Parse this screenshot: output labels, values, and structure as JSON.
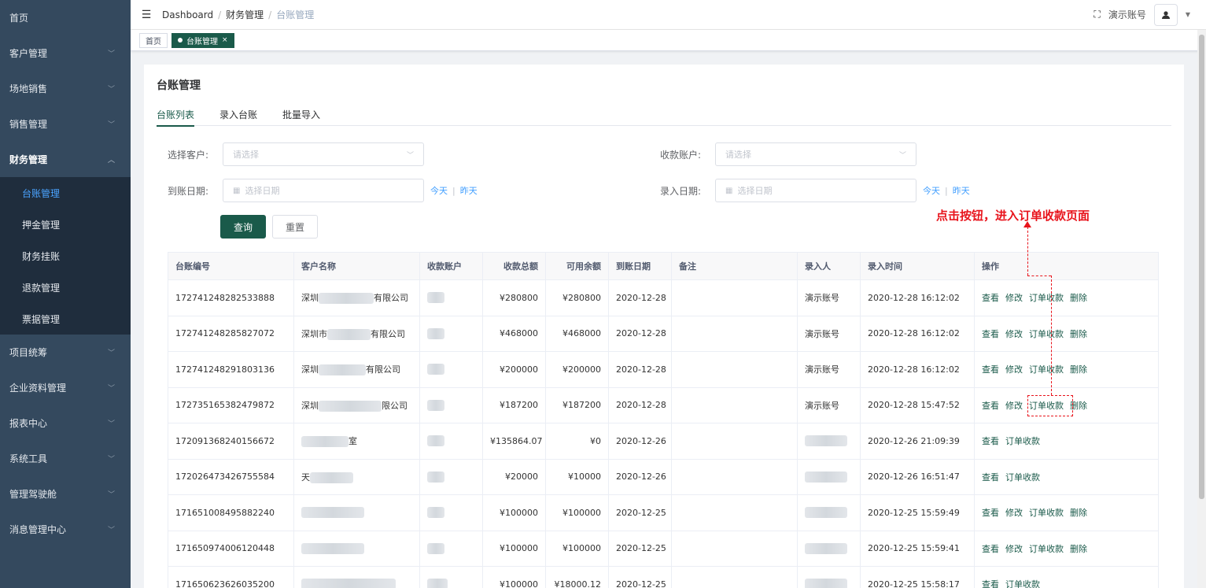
{
  "sidebar": {
    "items": [
      {
        "label": "首页"
      },
      {
        "label": "客户管理"
      },
      {
        "label": "场地销售"
      },
      {
        "label": "销售管理"
      },
      {
        "label": "财务管理"
      },
      {
        "label": "项目统筹"
      },
      {
        "label": "企业资料管理"
      },
      {
        "label": "报表中心"
      },
      {
        "label": "系统工具"
      },
      {
        "label": "管理驾驶舱"
      },
      {
        "label": "消息管理中心"
      }
    ],
    "finance_sub": [
      {
        "label": "台账管理"
      },
      {
        "label": "押金管理"
      },
      {
        "label": "财务挂账"
      },
      {
        "label": "退款管理"
      },
      {
        "label": "票据管理"
      }
    ]
  },
  "navbar": {
    "breadcrumb": [
      "Dashboard",
      "财务管理",
      "台账管理"
    ],
    "account": "演示账号"
  },
  "tags": {
    "home": "首页",
    "current": "台账管理"
  },
  "page": {
    "title": "台账管理",
    "tabs": [
      "台账列表",
      "录入台账",
      "批量导入"
    ]
  },
  "filters": {
    "customer_label": "选择客户:",
    "customer_placeholder": "请选择",
    "account_label": "收款账户:",
    "account_placeholder": "请选择",
    "arrival_label": "到账日期:",
    "arrival_placeholder": "选择日期",
    "entry_label": "录入日期:",
    "entry_placeholder": "选择日期",
    "today": "今天",
    "yesterday": "昨天",
    "search_btn": "查询",
    "reset_btn": "重置"
  },
  "table": {
    "headers": [
      "台账编号",
      "客户名称",
      "收款账户",
      "收款总额",
      "可用余额",
      "到账日期",
      "备注",
      "录入人",
      "录入时间",
      "操作"
    ],
    "rows": [
      {
        "id": "172741248282533888",
        "c1": "深圳",
        "c2": "有限公司",
        "total": "¥280800",
        "avail": "¥280800",
        "date": "2020-12-28",
        "user": "演示账号",
        "time": "2020-12-28 16:12:02",
        "ops": [
          "查看",
          "修改",
          "订单收款",
          "删除"
        ]
      },
      {
        "id": "172741248285827072",
        "c1": "深圳市",
        "c2": "有限公司",
        "total": "¥468000",
        "avail": "¥468000",
        "date": "2020-12-28",
        "user": "演示账号",
        "time": "2020-12-28 16:12:02",
        "ops": [
          "查看",
          "修改",
          "订单收款",
          "删除"
        ]
      },
      {
        "id": "172741248291803136",
        "c1": "深圳",
        "c2": "有限公司",
        "total": "¥200000",
        "avail": "¥200000",
        "date": "2020-12-28",
        "user": "演示账号",
        "time": "2020-12-28 16:12:02",
        "ops": [
          "查看",
          "修改",
          "订单收款",
          "删除"
        ]
      },
      {
        "id": "172735165382479872",
        "c1": "深圳",
        "c2": "限公司",
        "total": "¥187200",
        "avail": "¥187200",
        "date": "2020-12-28",
        "user": "演示账号",
        "time": "2020-12-28 15:47:52",
        "ops": [
          "查看",
          "修改",
          "订单收款",
          "删除"
        ]
      },
      {
        "id": "172091368240156672",
        "c1": "",
        "c2": "室",
        "total": "¥135864.07",
        "avail": "¥0",
        "date": "2020-12-26",
        "user": "",
        "time": "2020-12-26 21:09:39",
        "ops": [
          "查看",
          "订单收款"
        ]
      },
      {
        "id": "172026473426755584",
        "c1": "天",
        "c2": "",
        "total": "¥20000",
        "avail": "¥10000",
        "date": "2020-12-26",
        "user": "",
        "time": "2020-12-26 16:51:47",
        "ops": [
          "查看",
          "订单收款"
        ]
      },
      {
        "id": "171651008495882240",
        "c1": "",
        "c2": "",
        "total": "¥100000",
        "avail": "¥100000",
        "date": "2020-12-25",
        "user": "",
        "time": "2020-12-25 15:59:49",
        "ops": [
          "查看",
          "修改",
          "订单收款",
          "删除"
        ]
      },
      {
        "id": "171650974006120448",
        "c1": "",
        "c2": "",
        "total": "¥100000",
        "avail": "¥100000",
        "date": "2020-12-25",
        "user": "",
        "time": "2020-12-25 15:59:41",
        "ops": [
          "查看",
          "修改",
          "订单收款",
          "删除"
        ]
      },
      {
        "id": "171650623626035200",
        "c1": "",
        "c2": "",
        "total": "¥100000",
        "avail": "¥18000.12",
        "date": "2020-12-25",
        "user": "",
        "time": "2020-12-25 15:58:17",
        "ops": [
          "查看",
          "订单收款"
        ]
      }
    ]
  },
  "annotation": {
    "text": "点击按钮，进入订单收款页面"
  },
  "colors": {
    "sidebar": "#34495e",
    "primary": "#1a5a4a",
    "annotation": "#e8141c"
  }
}
